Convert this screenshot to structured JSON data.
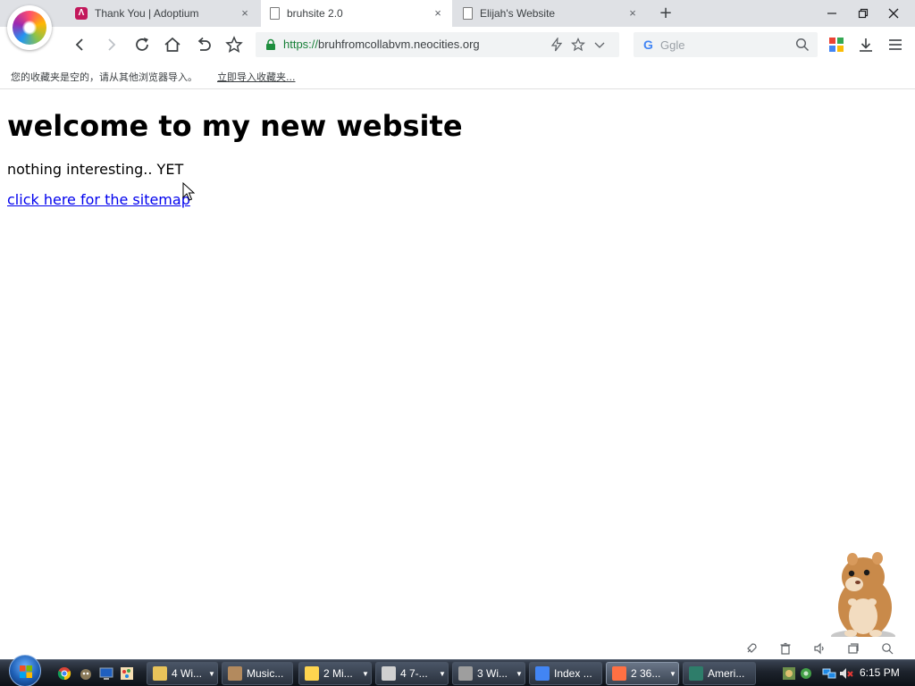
{
  "browser": {
    "tabs": [
      {
        "title": "Thank You | Adoptium",
        "active": false
      },
      {
        "title": "bruhsite 2.0",
        "active": true
      },
      {
        "title": "Elijah's Website",
        "active": false
      }
    ],
    "new_tab_label": "+",
    "tab_close_glyph": "×"
  },
  "toolbar": {
    "url_protocol": "https://",
    "url_host": "bruhfromcollabvm.neocities.org",
    "search_engine_glyph": "G",
    "search_placeholder": "Ggle"
  },
  "bookmarks_bar": {
    "message": "您的收藏夹是空的，请从其他浏览器导入。",
    "import_link": "立即导入收藏夹..."
  },
  "page": {
    "heading": "welcome to my new website",
    "paragraph": "nothing interesting.. YET",
    "link_text": "click here for the sitemap"
  },
  "taskbar": {
    "tasks": [
      {
        "label": "4 Wi...",
        "icon_color": "#e8c35a",
        "dropdown": true
      },
      {
        "label": "Music...",
        "icon_color": "#b38a5e",
        "dropdown": false
      },
      {
        "label": "2 Mi...",
        "icon_color": "#ffd54f",
        "dropdown": true
      },
      {
        "label": "4 7-...",
        "icon_color": "#d0d0d0",
        "dropdown": true
      },
      {
        "label": "3 Wi...",
        "icon_color": "#9e9e9e",
        "dropdown": true
      },
      {
        "label": "Index ...",
        "icon_color": "#4285f4",
        "dropdown": false
      },
      {
        "label": "2 36...",
        "icon_color": "#ff7043",
        "dropdown": true,
        "active": true
      },
      {
        "label": "Ameri...",
        "icon_color": "#2e7d6a",
        "dropdown": false
      }
    ],
    "clock": "6:15 PM"
  }
}
